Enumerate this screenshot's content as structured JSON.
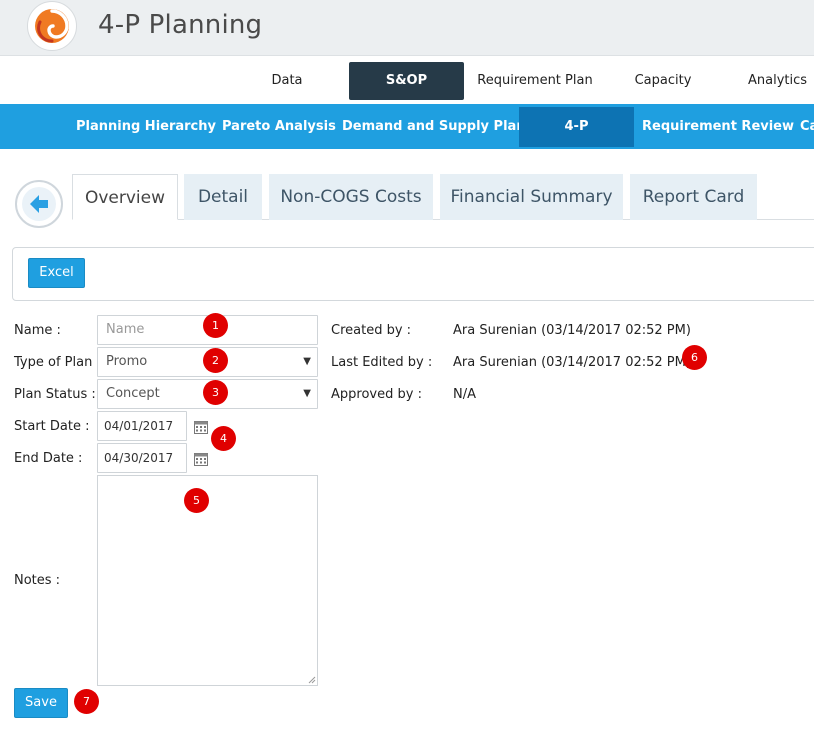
{
  "app": {
    "title": "4-P Planning",
    "logo_icon": "swirl-logo-icon"
  },
  "colors": {
    "accent": "#1f9fe0",
    "nav_dark": "#263a48",
    "subnav_active": "#0d73b3",
    "badge": "#e00000"
  },
  "nav_primary": {
    "items": [
      "Data",
      "S&OP",
      "Requirement Plan",
      "Capacity",
      "Analytics"
    ],
    "active": "S&OP"
  },
  "nav_secondary": {
    "items": [
      "Planning Hierarchy",
      "Pareto Analysis",
      "Demand and Supply Plan",
      "4-P",
      "Requirement Review",
      "Ca"
    ],
    "active": "4-P"
  },
  "tabs": {
    "items": [
      "Overview",
      "Detail",
      "Non-COGS Costs",
      "Financial Summary",
      "Report Card"
    ],
    "active": "Overview",
    "back_icon": "arrow-left-icon"
  },
  "toolbar": {
    "excel_label": "Excel"
  },
  "form": {
    "name_label": "Name :",
    "name_placeholder": "Name",
    "type_label": "Type of Plan :",
    "type_value": "Promo",
    "status_label": "Plan Status :",
    "status_value": "Concept",
    "start_label": "Start Date :",
    "start_value": "04/01/2017",
    "end_label": "End Date :",
    "end_value": "04/30/2017",
    "notes_label": "Notes :",
    "save_label": "Save"
  },
  "meta": {
    "created_label": "Created by :",
    "created_value": "Ara Surenian (03/14/2017 02:52 PM)",
    "edited_label": "Last Edited by :",
    "edited_value": "Ara Surenian (03/14/2017 02:52 PM)",
    "approved_label": "Approved by :",
    "approved_value": "N/A"
  },
  "badges": [
    "1",
    "2",
    "3",
    "4",
    "5",
    "6",
    "7"
  ]
}
